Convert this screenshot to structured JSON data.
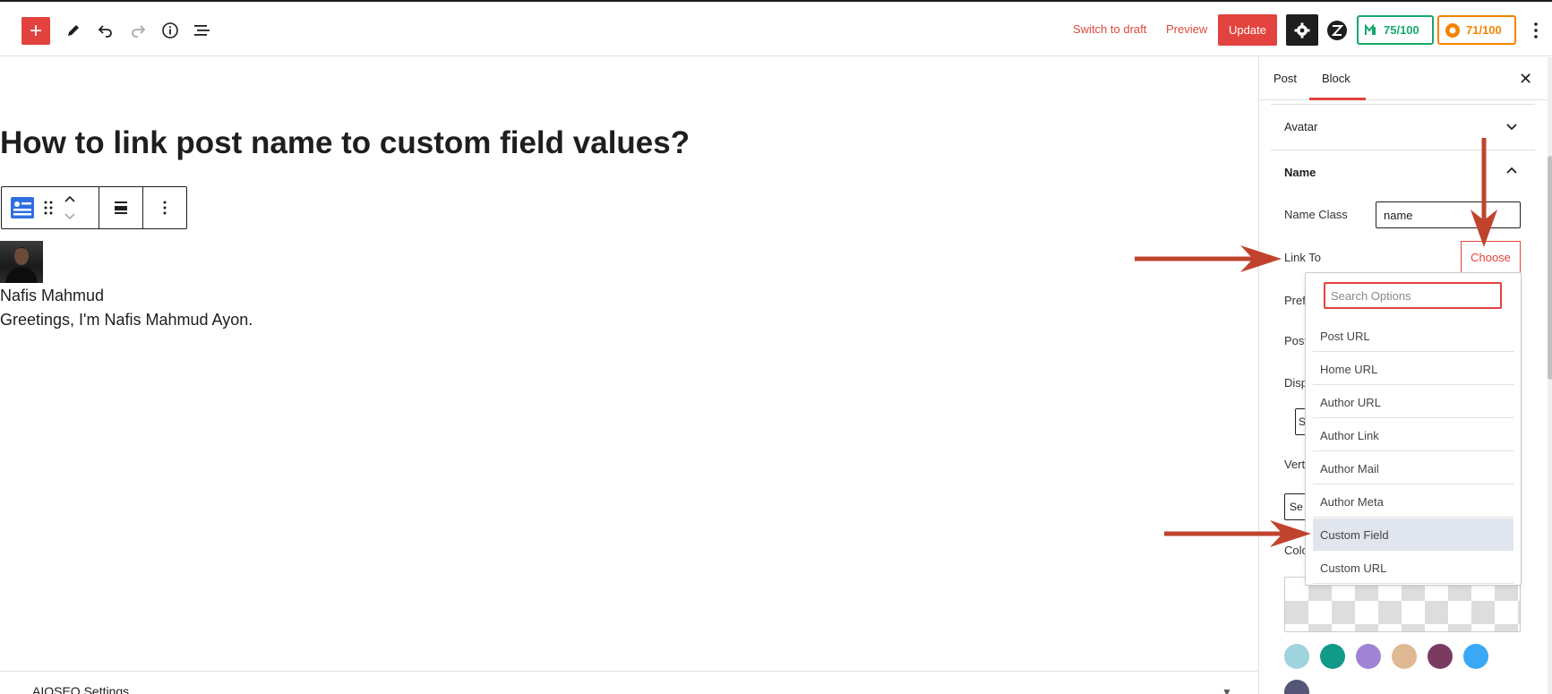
{
  "topbar": {
    "switch_to_draft": "Switch to draft",
    "preview": "Preview",
    "update": "Update",
    "score_green": "75/100",
    "score_orange": "71/100"
  },
  "editor": {
    "title": "How to link post name to custom field values?",
    "author_name": "Nafis Mahmud",
    "author_bio": "Greetings, I'm Nafis Mahmud Ayon.",
    "aioseo_label": "AIOSEO Settings"
  },
  "sidebar": {
    "tabs": [
      "Post",
      "Block"
    ],
    "active_tab": "Block",
    "panels": {
      "avatar": "Avatar",
      "name": "Name"
    },
    "name_class_label": "Name Class",
    "name_class_value": "name",
    "link_to_label": "Link To",
    "choose_label": "Choose",
    "cut_labels": [
      "Pref",
      "Post",
      "Disp",
      "Vert",
      "Colo"
    ],
    "stub_text": [
      "S",
      "Se"
    ],
    "swatches": [
      "#9fd3dd",
      "#11998a",
      "#a084d4",
      "#dfb894",
      "#7b3a62",
      "#3aa8f5",
      "#555577"
    ]
  },
  "dropdown": {
    "search_placeholder": "Search Options",
    "options": [
      "Post URL",
      "Home URL",
      "Author URL",
      "Author Link",
      "Author Mail",
      "Author Meta",
      "Custom Field",
      "Custom URL"
    ],
    "selected": "Custom Field"
  },
  "colors": {
    "accent": "#e2433f",
    "arrow": "#c0432e",
    "score_green": "#17a86b",
    "score_orange": "#f18500"
  }
}
